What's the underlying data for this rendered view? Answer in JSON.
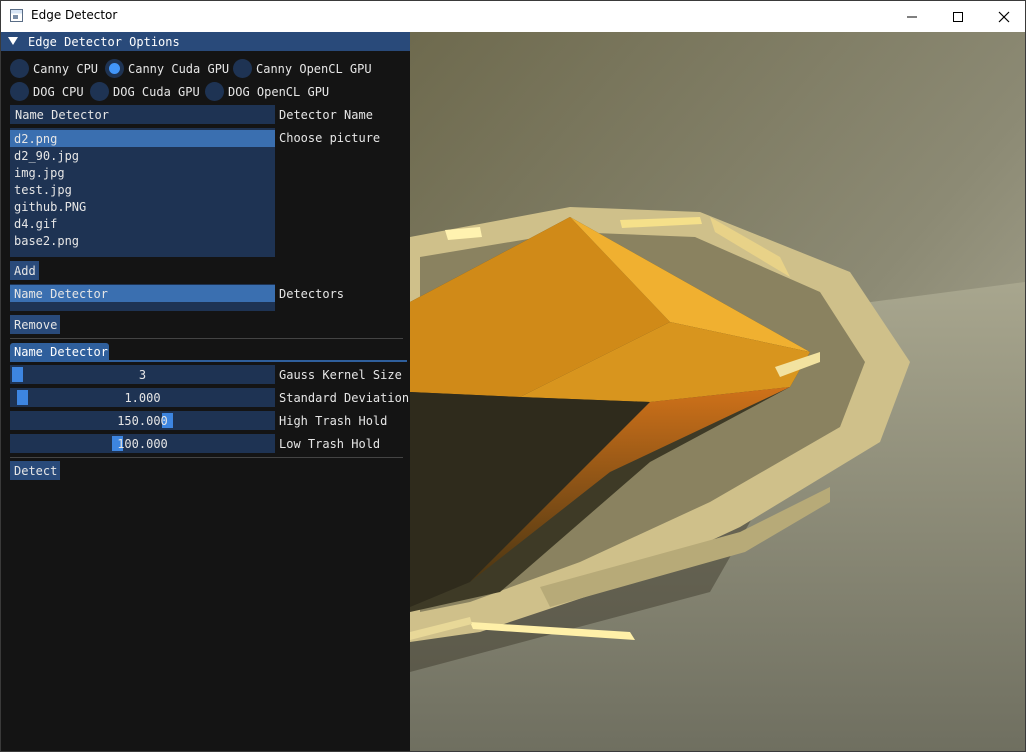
{
  "window": {
    "title": "Edge Detector"
  },
  "panel": {
    "header": "Edge Detector Options",
    "radios": [
      {
        "label": "Canny CPU",
        "selected": false
      },
      {
        "label": "Canny Cuda GPU",
        "selected": true
      },
      {
        "label": "Canny OpenCL GPU",
        "selected": false
      },
      {
        "label": "DOG CPU",
        "selected": false
      },
      {
        "label": "DOG Cuda GPU",
        "selected": false
      },
      {
        "label": "DOG OpenCL GPU",
        "selected": false
      }
    ],
    "name_input": {
      "value": "Name Detector",
      "label": "Detector Name"
    },
    "picture_list": {
      "label": "Choose picture",
      "items": [
        "d2.png",
        "d2_90.jpg",
        "img.jpg",
        "test.jpg",
        "github.PNG",
        "d4.gif",
        "base2.png"
      ],
      "selected_index": 0
    },
    "add_button": "Add",
    "detectors_list": {
      "label": "Detectors",
      "items": [
        "Name Detector"
      ]
    },
    "remove_button": "Remove",
    "tab": "Name Detector",
    "sliders": [
      {
        "value_text": "3",
        "label": "Gauss Kernel Size",
        "fraction": 0.0
      },
      {
        "value_text": "1.000",
        "label": "Standard Deviation",
        "fraction": 0.02
      },
      {
        "value_text": "150.000",
        "label": "High Trash Hold",
        "fraction": 0.6
      },
      {
        "value_text": "100.000",
        "label": "Low Trash Hold",
        "fraction": 0.4
      }
    ],
    "detect_button": "Detect"
  },
  "colors": {
    "accent": "#4296fa",
    "header": "#294a7a",
    "frame": "#1e3353",
    "selected_row": "#3a6fb0"
  }
}
